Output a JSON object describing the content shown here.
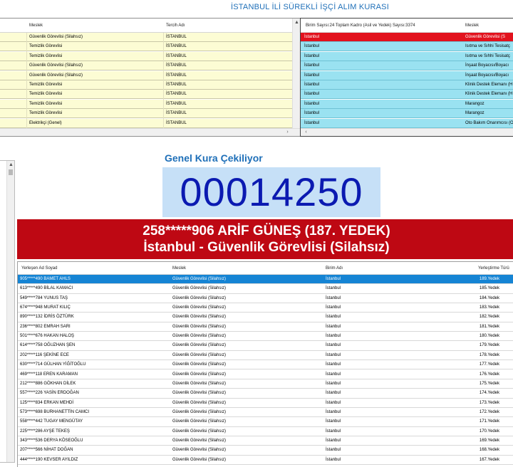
{
  "app": {
    "title": "İSTANBUL İLİ SÜREKLİ İŞÇİ ALIM KURASI"
  },
  "panel_a": {
    "headers": [
      "Meslek",
      "Tercih Adı"
    ],
    "rows": [
      {
        "meslek": "Güvenlik Görevlisi (Silahsız)",
        "tercih": "İSTANBUL"
      },
      {
        "meslek": "Temizlik Görevlisi",
        "tercih": "İSTANBUL"
      },
      {
        "meslek": "Temizlik Görevlisi",
        "tercih": "İSTANBUL"
      },
      {
        "meslek": "Güvenlik Görevlisi (Silahsız)",
        "tercih": "İSTANBUL"
      },
      {
        "meslek": "Güvenlik Görevlisi (Silahsız)",
        "tercih": "İSTANBUL"
      },
      {
        "meslek": "Temizlik Görevlisi",
        "tercih": "İSTANBUL"
      },
      {
        "meslek": "Temizlik Görevlisi",
        "tercih": "İSTANBUL"
      },
      {
        "meslek": "Temizlik Görevlisi",
        "tercih": "İSTANBUL"
      },
      {
        "meslek": "Temizlik Görevlisi",
        "tercih": "İSTANBUL"
      },
      {
        "meslek": "Elektrikçi (Genel)",
        "tercih": "İSTANBUL"
      }
    ]
  },
  "panel_b": {
    "headers": [
      "Birim Sayısı:24 Toplam Kadro (Asil ve Yedek) Sayısı:3374",
      "Meslek"
    ],
    "rows": [
      {
        "birim": "İstanbul",
        "meslek": "Güvenlik Görevlisi (S"
      },
      {
        "birim": "İstanbul",
        "meslek": "Isıtma ve Sıhhi Tesisatç"
      },
      {
        "birim": "İstanbul",
        "meslek": "Isıtma ve Sıhhi Tesisatç"
      },
      {
        "birim": "İstanbul",
        "meslek": "İnşaat Boyacısı/Boyacı"
      },
      {
        "birim": "İstanbul",
        "meslek": "İnşaat Boyacısı/Boyacı"
      },
      {
        "birim": "İstanbul",
        "meslek": "Klinik Destek Elemanı (H"
      },
      {
        "birim": "İstanbul",
        "meslek": "Klinik Destek Elemanı (H"
      },
      {
        "birim": "İstanbul",
        "meslek": "Marangoz"
      },
      {
        "birim": "İstanbul",
        "meslek": "Marangoz"
      },
      {
        "birim": "İstanbul",
        "meslek": "Oto Bakım Onarımcısı (O"
      }
    ]
  },
  "draw": {
    "label": "Genel Kura Çekiliyor",
    "number": "00014250",
    "winner_line1": "258*****906 ARİF GÜNEŞ (187. YEDEK)",
    "winner_line2": "İstanbul - Güvenlik Görevlisi (Silahsız)"
  },
  "results": {
    "headers": [
      "Yerleşen Ad Soyad",
      "Meslek",
      "Birim Adı",
      "Yerleştirme Türü"
    ],
    "rows": [
      {
        "name": "905*****490 BAMET AHLS",
        "meslek": "Güvenlik Görevlisi (Silahsız)",
        "birim": "İstanbul",
        "tur": "189.Yedek"
      },
      {
        "name": "613*****490 BİLAL KAMACI",
        "meslek": "Güvenlik Görevlisi (Silahsız)",
        "birim": "İstanbul",
        "tur": "185.Yedek"
      },
      {
        "name": "549*****784 YUNUS TAŞ",
        "meslek": "Güvenlik Görevlisi (Silahsız)",
        "birim": "İstanbul",
        "tur": "184.Yedek"
      },
      {
        "name": "674*****948 MURAT KILIÇ",
        "meslek": "Güvenlik Görevlisi (Silahsız)",
        "birim": "İstanbul",
        "tur": "183.Yedek"
      },
      {
        "name": "890*****132 İDRİS ÖZTÜRK",
        "meslek": "Güvenlik Görevlisi (Silahsız)",
        "birim": "İstanbul",
        "tur": "182.Yedek"
      },
      {
        "name": "236*****802 EMRAH SARI",
        "meslek": "Güvenlik Görevlisi (Silahsız)",
        "birim": "İstanbul",
        "tur": "181.Yedek"
      },
      {
        "name": "501*****676 HAKAN HALOŞ",
        "meslek": "Güvenlik Görevlisi (Silahsız)",
        "birim": "İstanbul",
        "tur": "180.Yedek"
      },
      {
        "name": "614*****758 OĞUZHAN ŞEN",
        "meslek": "Güvenlik Görevlisi (Silahsız)",
        "birim": "İstanbul",
        "tur": "179.Yedek"
      },
      {
        "name": "202*****116 ŞEKİNE ECE",
        "meslek": "Güvenlik Görevlisi (Silahsız)",
        "birim": "İstanbul",
        "tur": "178.Yedek"
      },
      {
        "name": "630*****714 GÜLHAN YİĞİTOĞLU",
        "meslek": "Güvenlik Görevlisi (Silahsız)",
        "birim": "İstanbul",
        "tur": "177.Yedek"
      },
      {
        "name": "469*****118 EREN KARAMAN",
        "meslek": "Güvenlik Görevlisi (Silahsız)",
        "birim": "İstanbul",
        "tur": "176.Yedek"
      },
      {
        "name": "212*****886 GÖKHAN DİLEK",
        "meslek": "Güvenlik Görevlisi (Silahsız)",
        "birim": "İstanbul",
        "tur": "175.Yedek"
      },
      {
        "name": "557*****226 YASİN ERDOĞAN",
        "meslek": "Güvenlik Görevlisi (Silahsız)",
        "birim": "İstanbul",
        "tur": "174.Yedek"
      },
      {
        "name": "125*****834 ERKAN MEHDİ",
        "meslek": "Güvenlik Görevlisi (Silahsız)",
        "birim": "İstanbul",
        "tur": "173.Yedek"
      },
      {
        "name": "573*****698 BURHANETTİN CAMCI",
        "meslek": "Güvenlik Görevlisi (Silahsız)",
        "birim": "İstanbul",
        "tur": "172.Yedek"
      },
      {
        "name": "558*****442 TUGAY MENGÜTAY",
        "meslek": "Güvenlik Görevlisi (Silahsız)",
        "birim": "İstanbul",
        "tur": "171.Yedek"
      },
      {
        "name": "225*****286 AYŞE TEKEŞ",
        "meslek": "Güvenlik Görevlisi (Silahsız)",
        "birim": "İstanbul",
        "tur": "170.Yedek"
      },
      {
        "name": "343*****536 DERYA KÖSEOĞLU",
        "meslek": "Güvenlik Görevlisi (Silahsız)",
        "birim": "İstanbul",
        "tur": "169.Yedek"
      },
      {
        "name": "207*****566 NİHAT DOĞAN",
        "meslek": "Güvenlik Görevlisi (Silahsız)",
        "birim": "İstanbul",
        "tur": "168.Yedek"
      },
      {
        "name": "444*****190 KEVSER AYILDIZ",
        "meslek": "Güvenlik Görevlisi (Silahsız)",
        "birim": "İstanbul",
        "tur": "167.Yedek"
      }
    ]
  },
  "colors": {
    "accent_blue": "#1e6fb8",
    "counter_bg": "#c6e0f7",
    "counter_text": "#0b1ab1",
    "winner_bg": "#be0813",
    "selected_row": "#1584d4",
    "panel_a_row": "#fcfcd4",
    "panel_b_row": "#9ae2f1",
    "panel_b_selected": "#e2121d"
  },
  "icons": {
    "scroll_up": "▲",
    "scroll_down": "▼",
    "scroll_left": "‹",
    "scroll_right": "›"
  }
}
